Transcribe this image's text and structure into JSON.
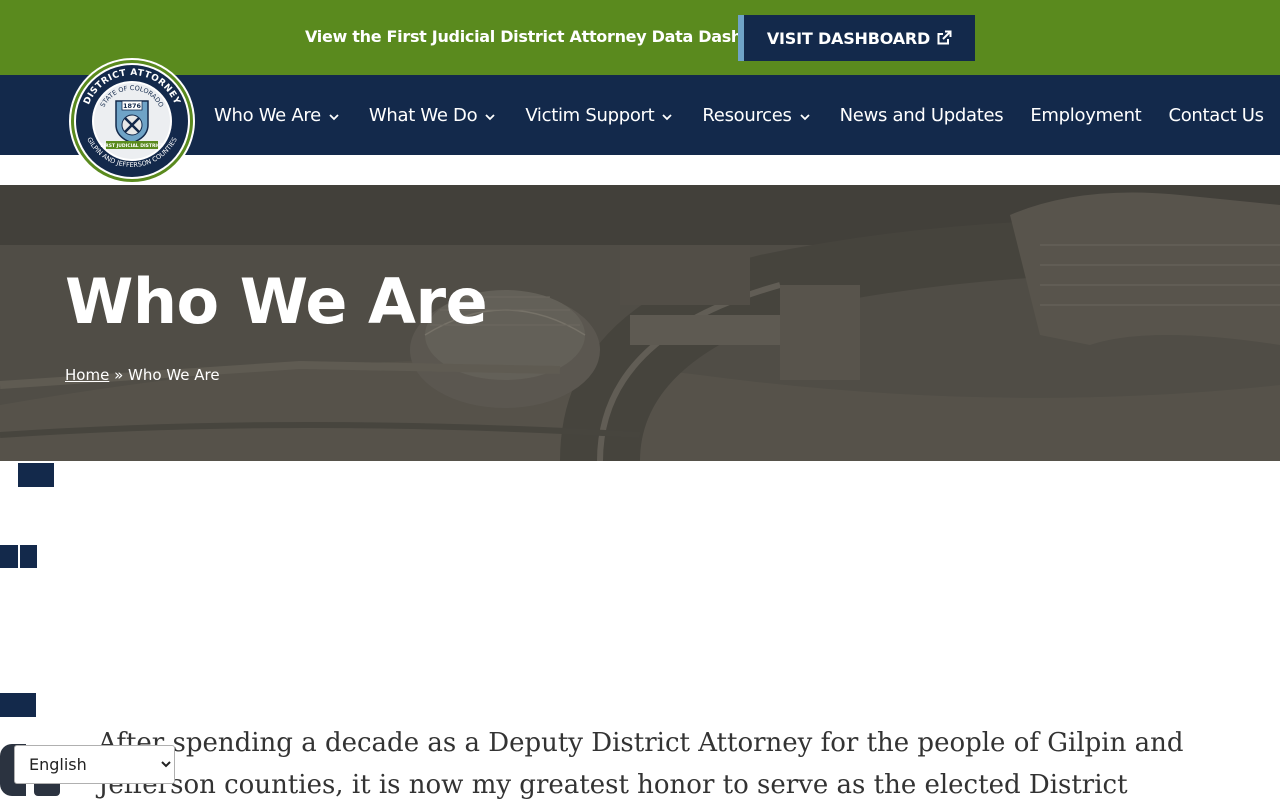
{
  "topbar": {
    "message": "View the First Judicial District Attorney Data Dashboard",
    "button_label": "VISIT DASHBOARD",
    "button_icon": "external-link-icon",
    "bg_color": "#5a8a1e",
    "button_color": "#13294b"
  },
  "logo": {
    "ring_top": "DISTRICT ATTORNEY",
    "ring_inner": "STATE OF COLORADO",
    "year": "1876",
    "band": "FIRST JUDICIAL DISTRICT",
    "ring_bottom": "GILPIN AND JEFFERSON COUNTIES"
  },
  "nav": {
    "items": [
      {
        "label": "Who We Are",
        "has_dropdown": true
      },
      {
        "label": "What We Do",
        "has_dropdown": true
      },
      {
        "label": "Victim Support",
        "has_dropdown": true
      },
      {
        "label": "Resources",
        "has_dropdown": true
      },
      {
        "label": "News and Updates",
        "has_dropdown": false
      },
      {
        "label": "Employment",
        "has_dropdown": false
      },
      {
        "label": "Contact Us",
        "has_dropdown": false
      }
    ],
    "bg_color": "#13294b"
  },
  "hero": {
    "title": "Who We Are",
    "breadcrumb": {
      "home": "Home",
      "separator": "»",
      "current": "Who We Are"
    }
  },
  "content": {
    "intro": "After spending a decade as a Deputy District Attorney for the people of Gilpin and Jefferson counties, it is now my greatest honor to serve as the elected District"
  },
  "language_select": {
    "selected": "English",
    "options": [
      "English"
    ]
  }
}
